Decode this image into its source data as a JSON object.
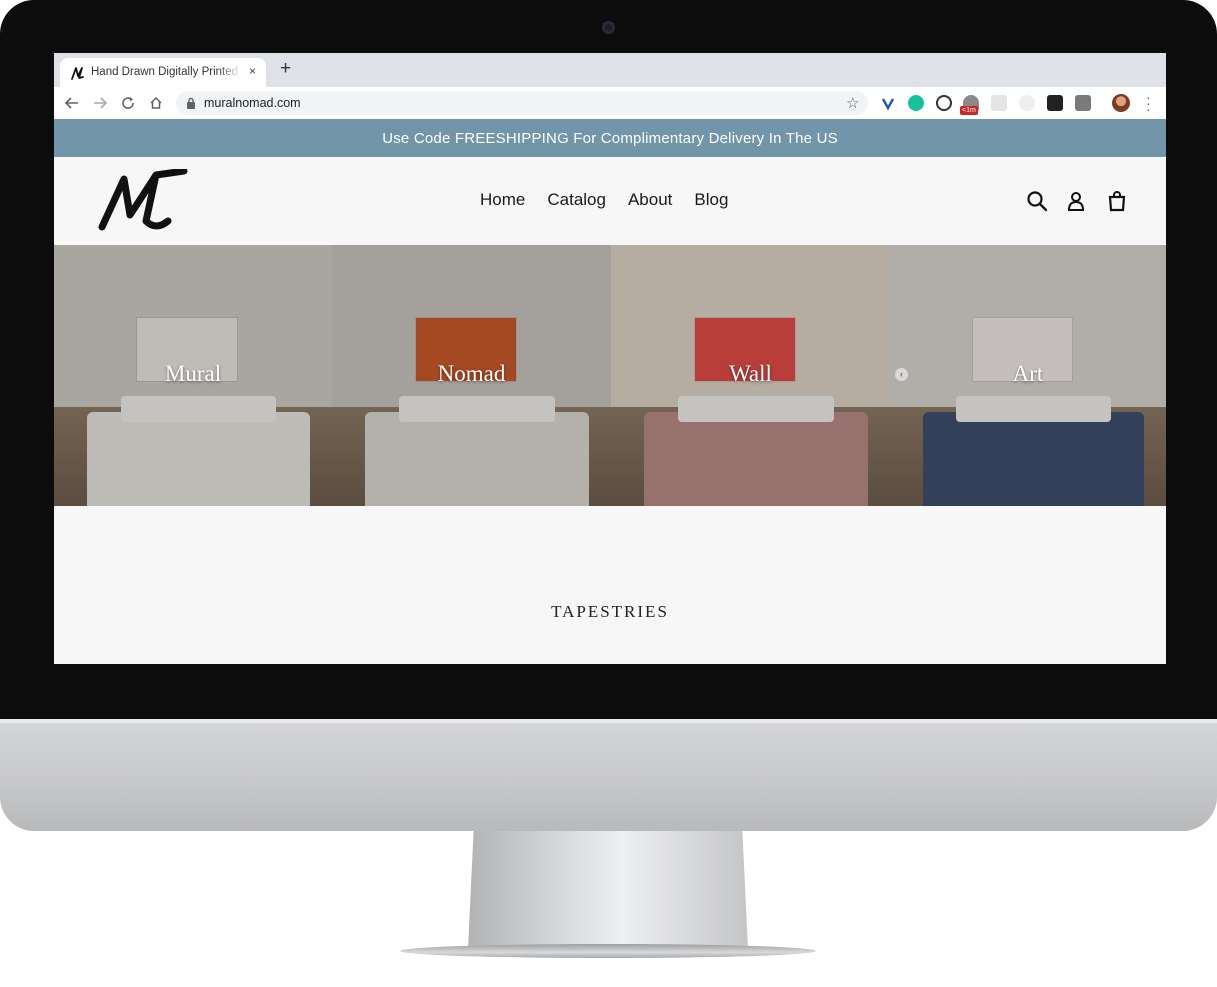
{
  "browser": {
    "tab_title": "Hand Drawn Digitally Printed Wall Tapestries",
    "tab_close": "×",
    "new_tab": "+",
    "url": "muralnomad.com",
    "extension_badge": "<1m"
  },
  "announcement": {
    "text": "Use Code FREESHIPPING For Complimentary Delivery In The US"
  },
  "header": {
    "logo_alt": "Mural Nomad",
    "nav": [
      {
        "label": "Home"
      },
      {
        "label": "Catalog"
      },
      {
        "label": "About"
      },
      {
        "label": "Blog"
      }
    ],
    "icons": [
      "search-icon",
      "account-icon",
      "cart-icon"
    ]
  },
  "hero": {
    "panels": [
      {
        "label": "Mural",
        "wall": "#cfcac3",
        "art": "#e9e6e0",
        "bed": "#e7e4df"
      },
      {
        "label": "Nomad",
        "wall": "#c9c4bd",
        "art": "#c85a2a",
        "bed": "#dcd8d1"
      },
      {
        "label": "Wall",
        "wall": "#ddd3c6",
        "art": "#e24b45",
        "bed": "#b98a86"
      },
      {
        "label": "Art",
        "wall": "#d8d4cf",
        "art": "#efeae6",
        "bed": "#3f4f6e"
      }
    ]
  },
  "section": {
    "title": "TAPESTRIES"
  },
  "colors": {
    "announcement_bg": "#7395aa",
    "page_bg": "#f7f7f7",
    "bezel": "#0c0c0c"
  }
}
